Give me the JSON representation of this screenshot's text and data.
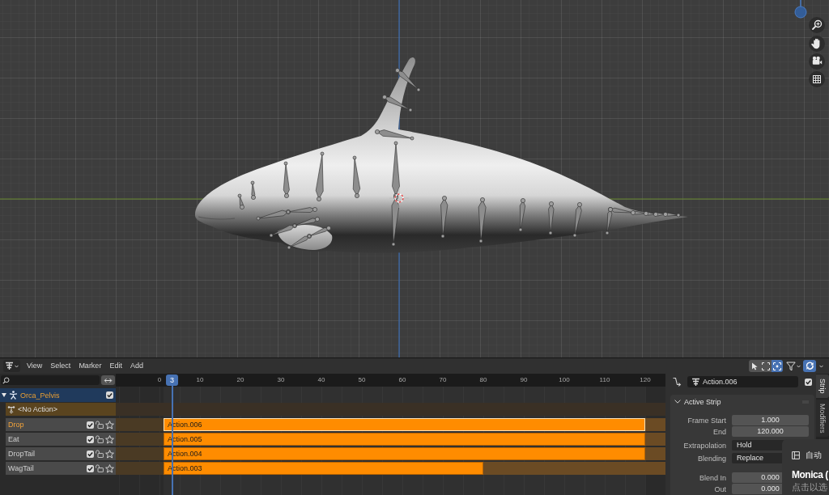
{
  "nla_editor": {
    "menu": [
      "View",
      "Select",
      "Marker",
      "Edit",
      "Add"
    ],
    "header_toggles": [
      {
        "kind": "arrow",
        "on": false
      },
      {
        "kind": "frame",
        "on": false
      },
      {
        "kind": "dotted-frame",
        "on": true
      }
    ],
    "snapping": {
      "on": true
    },
    "ruler": {
      "labels": [
        "0",
        "10",
        "20",
        "30",
        "40",
        "50",
        "60",
        "70",
        "80",
        "90",
        "100",
        "110",
        "120"
      ],
      "current_frame": "3"
    },
    "object": {
      "name": "Orca_Pelvis",
      "expanded": true,
      "checked": true
    },
    "action_line": {
      "label": "<No Action>"
    },
    "tracks": [
      {
        "name": "Drop",
        "selected": true,
        "enabled": true,
        "locked": false,
        "solo": false,
        "strip": {
          "label": "Action.006",
          "selected": true,
          "level": 1
        }
      },
      {
        "name": "Eat",
        "selected": false,
        "enabled": true,
        "locked": false,
        "solo": false,
        "strip": {
          "label": "Action.005",
          "selected": false,
          "level": 1
        }
      },
      {
        "name": "DropTail",
        "selected": false,
        "enabled": true,
        "locked": false,
        "solo": false,
        "strip": {
          "label": "Action.004",
          "selected": false,
          "level": 1
        }
      },
      {
        "name": "WagTail",
        "selected": false,
        "enabled": true,
        "locked": false,
        "solo": false,
        "strip": {
          "label": "Action.003",
          "selected": false,
          "level": 0.664
        }
      }
    ]
  },
  "sidebar": {
    "strip_name": "Action.006",
    "checked": true,
    "panel": {
      "title": "Active Strip",
      "expanded": true,
      "groups": [
        {
          "fields": [
            {
              "label": "Frame Start",
              "value": "1.000",
              "kind": "number"
            },
            {
              "label": "End",
              "value": "120.000",
              "kind": "number"
            }
          ]
        },
        {
          "fields": [
            {
              "label": "Extrapolation",
              "value": "Hold",
              "kind": "dropdown"
            },
            {
              "label": "Blending",
              "value": "Replace",
              "kind": "dropdown"
            }
          ]
        },
        {
          "fields": [
            {
              "label": "Blend In",
              "value": "0.000",
              "kind": "number"
            },
            {
              "label": "Out",
              "value": "0.000",
              "kind": "number"
            }
          ]
        }
      ]
    },
    "tabs": [
      {
        "label": "Strip",
        "selected": true
      },
      {
        "label": "Modifiers",
        "selected": false
      }
    ]
  },
  "popup": {
    "item": "自动",
    "title": "Monica (",
    "subtitle": "点击以选"
  }
}
